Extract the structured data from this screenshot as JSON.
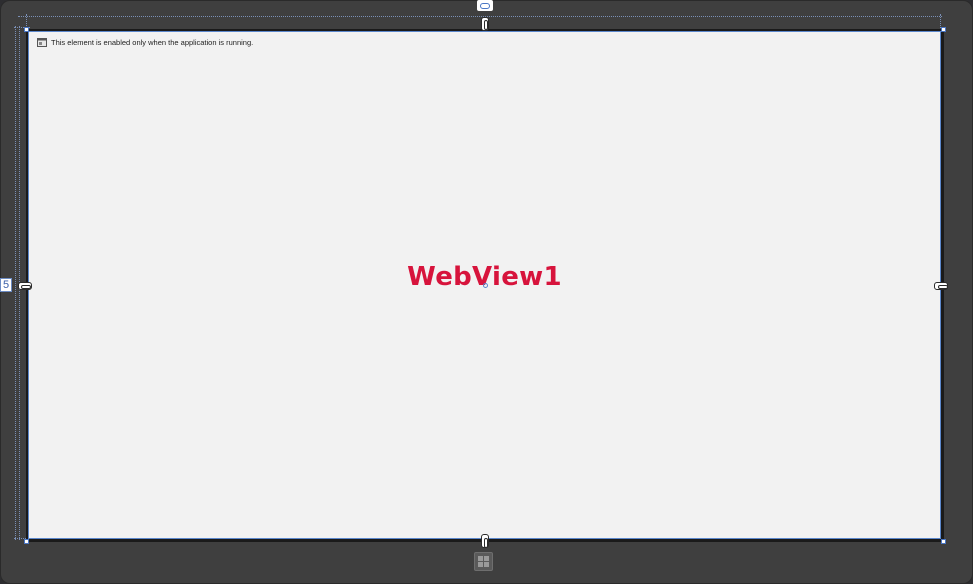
{
  "designer": {
    "element_name": "WebView1",
    "notice_text": "This element is enabled only when the application is running.",
    "left_margin_value": "5",
    "icons": {
      "notice": "webview-info-icon",
      "windows": "windows-start-icon",
      "top_adorner": "margin-adorner-icon"
    },
    "colors": {
      "element_name": "#d7143c",
      "selection": "#5b87cc",
      "canvas": "#f2f2f2",
      "frame": "#3f3f3f"
    }
  }
}
